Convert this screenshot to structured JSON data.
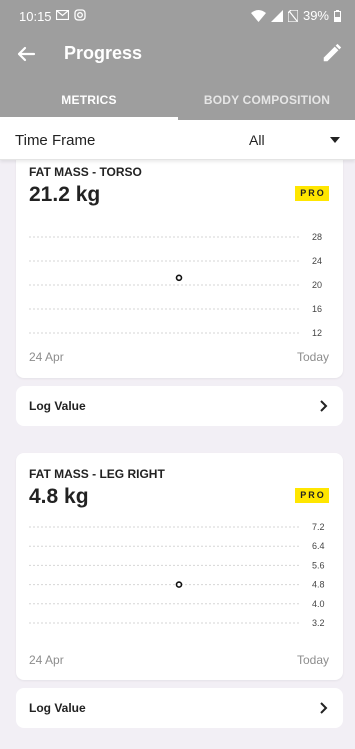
{
  "status_bar": {
    "time": "10:15",
    "battery": "39%",
    "icons_left": [
      "gmail-icon",
      "instagram-icon"
    ],
    "icons_right": [
      "wifi-icon",
      "signal-icon",
      "no-sim-icon",
      "battery-icon"
    ]
  },
  "appbar": {
    "title": "Progress",
    "back_icon": "back-arrow-icon",
    "edit_icon": "pencil-icon"
  },
  "tabs": [
    {
      "label": "METRICS",
      "active": true
    },
    {
      "label": "BODY COMPOSITION",
      "active": false
    }
  ],
  "timeframe": {
    "label": "Time Frame",
    "value": "All"
  },
  "cards": [
    {
      "name": "FAT MASS - TORSO",
      "value": "21.2 kg",
      "badge": "PRO",
      "date_start": "24 Apr",
      "date_end": "Today",
      "log_label": "Log Value",
      "chart_data": {
        "type": "scatter",
        "y_ticks": [
          "28",
          "24",
          "20",
          "16",
          "12"
        ],
        "ylim": [
          12,
          28
        ],
        "points": [
          {
            "x": "mid",
            "y": 21.2
          }
        ]
      }
    },
    {
      "name": "FAT MASS - LEG RIGHT",
      "value": "4.8 kg",
      "badge": "PRO",
      "date_start": "24 Apr",
      "date_end": "Today",
      "log_label": "Log Value",
      "chart_data": {
        "type": "scatter",
        "y_ticks": [
          "7.2",
          "6.4",
          "5.6",
          "4.8",
          "4.0",
          "3.2"
        ],
        "ylim": [
          3.2,
          7.2
        ],
        "points": [
          {
            "x": "mid",
            "y": 4.8
          }
        ]
      }
    }
  ],
  "colors": {
    "header": "#9e9e9e",
    "badge": "#ffe600",
    "background": "#f2eff5"
  }
}
